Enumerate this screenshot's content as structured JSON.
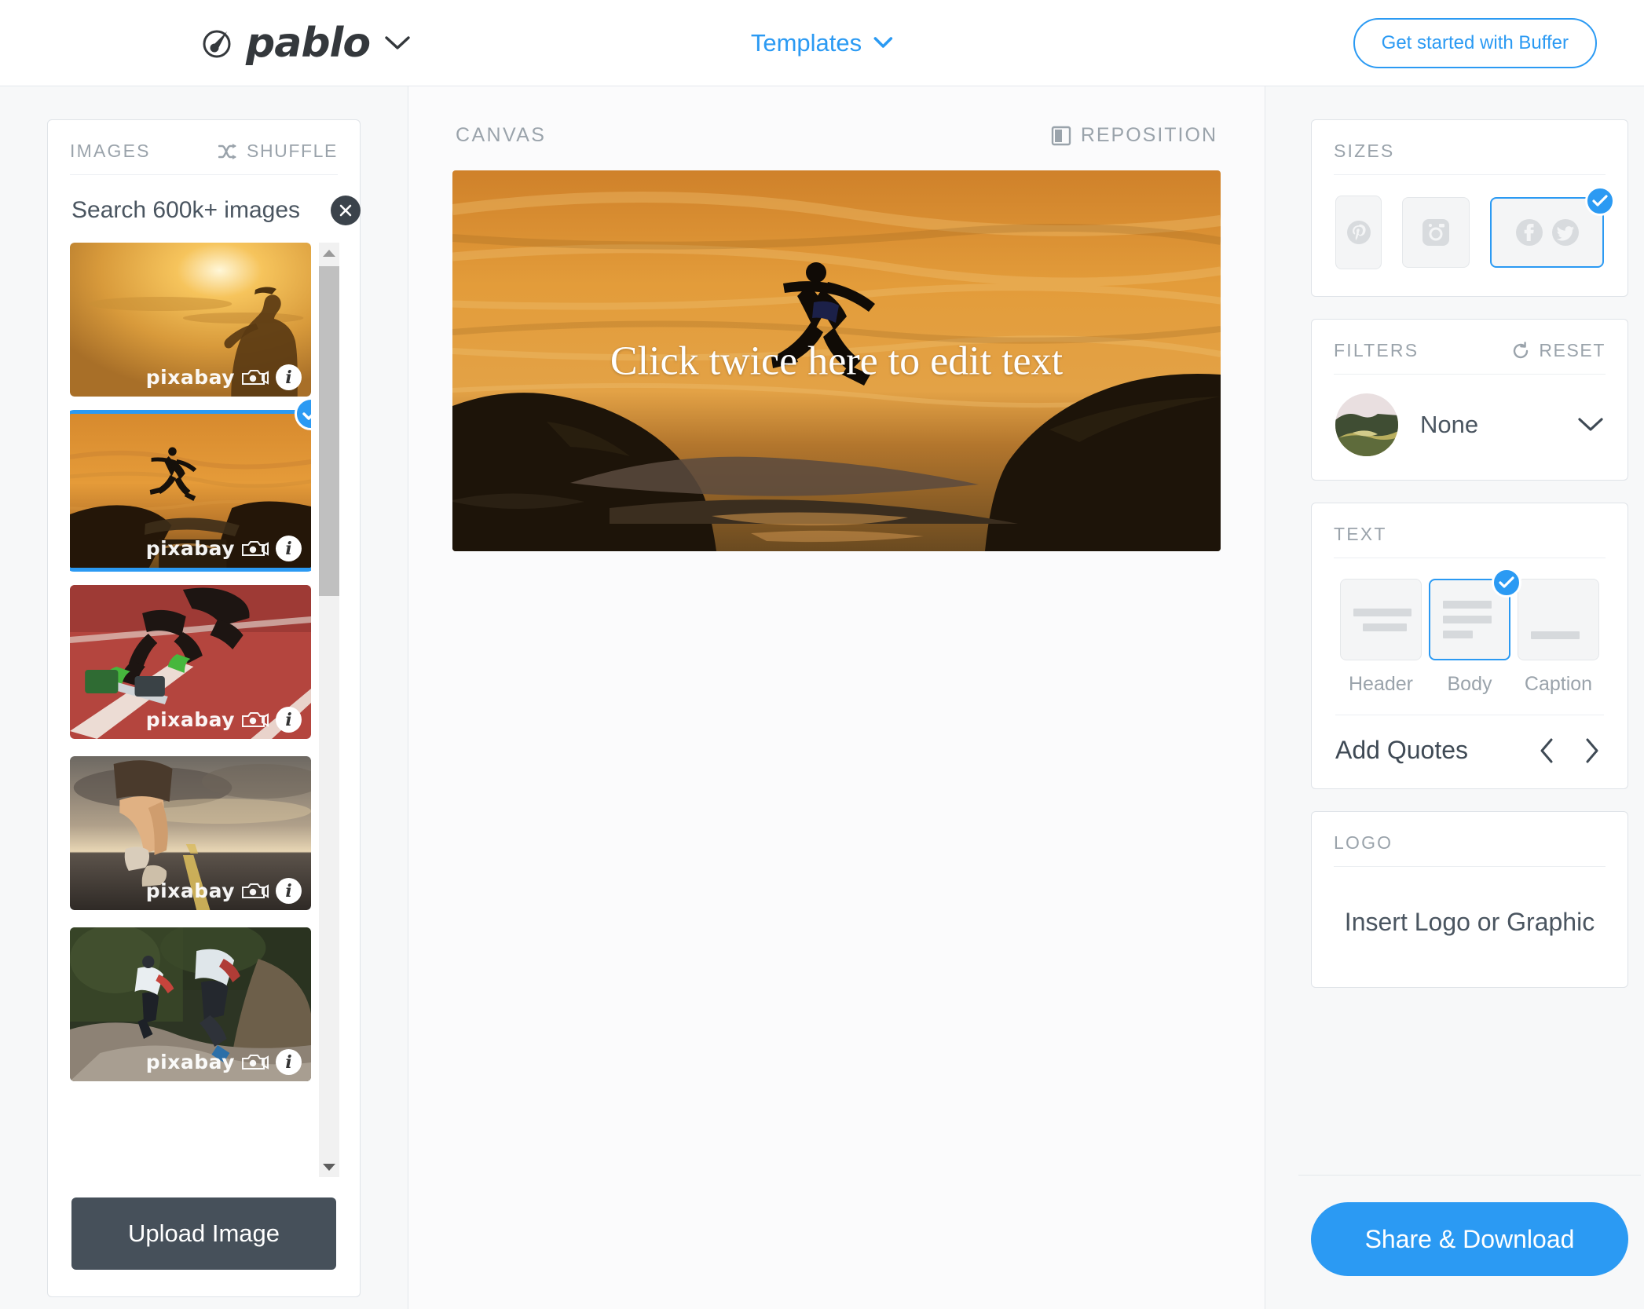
{
  "header": {
    "brand_name": "pablo",
    "brand_icon": "pablo-circle-brush-icon",
    "brand_chevron_icon": "chevron-down-icon",
    "templates_label": "Templates",
    "templates_chevron_icon": "chevron-down-icon",
    "get_started_label": "Get started with Buffer"
  },
  "images_panel": {
    "title": "IMAGES",
    "shuffle_label": "SHUFFLE",
    "shuffle_icon": "shuffle-icon",
    "search_value": "Search 600k+ images",
    "search_placeholder": "Search 600k+ images",
    "clear_icon": "close-icon",
    "upload_label": "Upload Image",
    "watermark_text": "pixabay",
    "watermark_info": "i",
    "scroll_up_icon": "triangle-up-icon",
    "scroll_down_icon": "triangle-down-icon",
    "thumbnails": [
      {
        "alt": "woman running at sunset silhouette",
        "selected": false
      },
      {
        "alt": "person leaping between rocks at sunset",
        "selected": true
      },
      {
        "alt": "sprinters in starting blocks on red track",
        "selected": false
      },
      {
        "alt": "runner legs on open road at dusk",
        "selected": false
      },
      {
        "alt": "two trail runners on forest rocky path",
        "selected": false
      }
    ]
  },
  "canvas": {
    "title": "CANVAS",
    "reposition_label": "REPOSITION",
    "reposition_icon": "reposition-icon",
    "text": "Click twice here to edit text"
  },
  "sizes": {
    "title": "SIZES",
    "options": [
      {
        "name": "pinterest",
        "icon": "pinterest-icon",
        "selected": false
      },
      {
        "name": "instagram",
        "icon": "instagram-icon",
        "selected": false
      },
      {
        "name": "facebook-twitter",
        "icon": "facebook-twitter-icon",
        "selected": true
      }
    ],
    "check_icon": "check-icon"
  },
  "filters": {
    "title": "FILTERS",
    "reset_label": "RESET",
    "reset_icon": "reset-icon",
    "selected": "None",
    "chevron_icon": "chevron-down-icon"
  },
  "text_section": {
    "title": "TEXT",
    "options": [
      {
        "label": "Header",
        "selected": false
      },
      {
        "label": "Body",
        "selected": true
      },
      {
        "label": "Caption",
        "selected": false
      }
    ],
    "quotes_label": "Add Quotes",
    "prev_icon": "chevron-left-icon",
    "next_icon": "chevron-right-icon"
  },
  "logo_section": {
    "title": "LOGO",
    "placeholder": "Insert Logo or Graphic"
  },
  "footer": {
    "share_label": "Share & Download"
  },
  "colors": {
    "accent": "#2b9af3",
    "muted_text": "#9aa3ab",
    "dark_button": "#46505a",
    "page_bg": "#f7f8f9"
  }
}
